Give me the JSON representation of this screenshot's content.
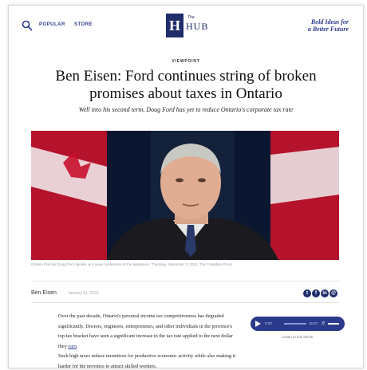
{
  "nav": {
    "links": [
      "POPULAR",
      "STORE"
    ],
    "logo_letter": "H",
    "logo_the": "The",
    "logo_name": "HUB",
    "tagline_line1": "Bold Ideas for",
    "tagline_line2": "a Better Future"
  },
  "article": {
    "kicker": "VIEWPOINT",
    "headline": "Ben Eisen: Ford continues string of broken promises about taxes in Ontario",
    "dek": "Well into his second term, Doug Ford has yet to reduce Ontario's corporate tax rate",
    "caption": "Ontario Premier Doug Ford speaks at a news conference at the legislature, Thursday, November 3, 2022. The Canadian Press.",
    "author": "Ben Eisen",
    "date": "January 31, 2023",
    "paragraph1": "Over the past decade, Ontario's personal income tax competitiveness has degraded significantly. Doctors, engineers, entrepreneurs, and other individuals in the province's top tax bracket have seen a significant increase in the tax rate applied to the next dollar they",
    "paragraph1_link": "earn",
    "paragraph2": "Such high taxes reduce incentives for productive economic activity while also making it harder for the province to attract skilled workers."
  },
  "share": {
    "icons": [
      "twitter-icon",
      "facebook-icon",
      "linkedin-icon",
      "email-icon"
    ],
    "glyphs": [
      "t",
      "f",
      "in",
      "@"
    ]
  },
  "audio": {
    "current": "0:00",
    "duration": "15:27",
    "listen_label": "Listen to this article"
  },
  "colors": {
    "brand_navy": "#1f2d6b",
    "accent_blue": "#2c3a8c",
    "flag_red": "#c8102e"
  }
}
